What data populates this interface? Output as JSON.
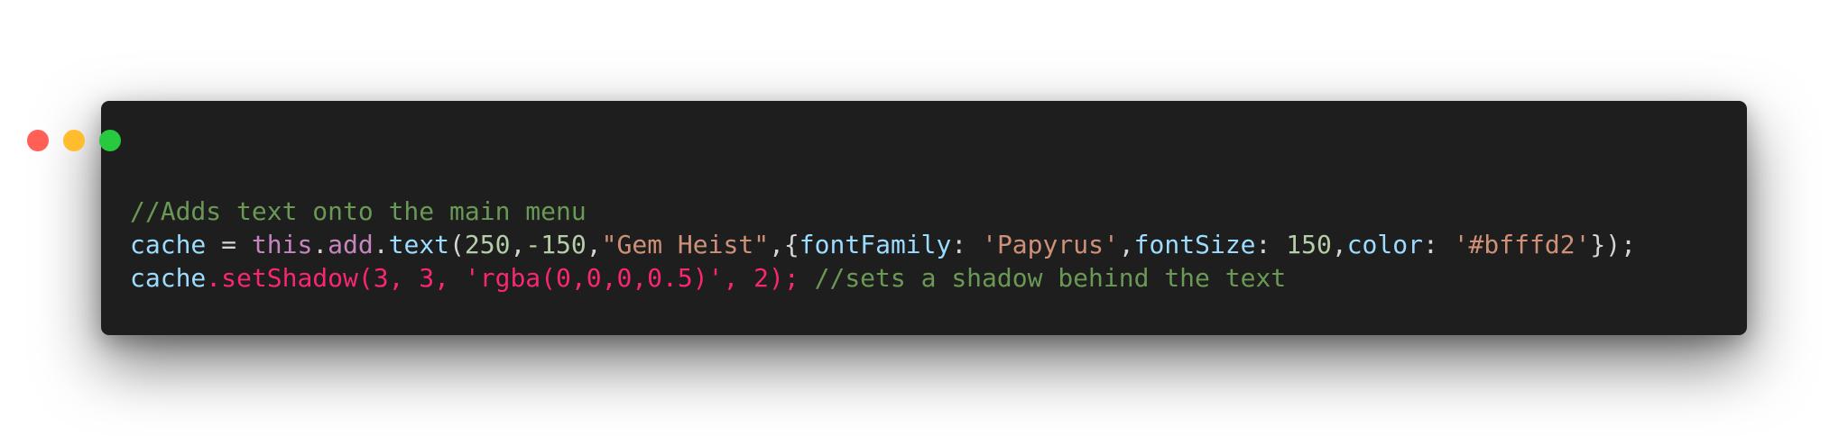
{
  "window": {
    "background": "#1e1e1e",
    "controls": [
      {
        "name": "close",
        "color": "#ff5f56"
      },
      {
        "name": "minimize",
        "color": "#ffbd2e"
      },
      {
        "name": "maximize",
        "color": "#27c93f"
      }
    ]
  },
  "colors": {
    "comment": "#6a9955",
    "variable": "#9cdcfe",
    "plain": "#d4d4d4",
    "keyword": "#c586c0",
    "function": "#dcdcaa",
    "number": "#b5cea8",
    "string": "#ce9178",
    "pink": "#f92672"
  },
  "code": {
    "line1": [
      {
        "t": "//Adds text onto the main menu",
        "c": "comment"
      }
    ],
    "line2": [
      {
        "t": "cache",
        "c": "variable"
      },
      {
        "t": " = ",
        "c": "plain"
      },
      {
        "t": "this",
        "c": "keyword"
      },
      {
        "t": ".",
        "c": "plain"
      },
      {
        "t": "add",
        "c": "keyword"
      },
      {
        "t": ".",
        "c": "plain"
      },
      {
        "t": "text",
        "c": "variable"
      },
      {
        "t": "(",
        "c": "plain"
      },
      {
        "t": "250",
        "c": "number"
      },
      {
        "t": ",",
        "c": "plain"
      },
      {
        "t": "-150",
        "c": "number"
      },
      {
        "t": ",",
        "c": "plain"
      },
      {
        "t": "\"Gem Heist\"",
        "c": "string"
      },
      {
        "t": ",{",
        "c": "plain"
      },
      {
        "t": "fontFamily",
        "c": "variable"
      },
      {
        "t": ": ",
        "c": "plain"
      },
      {
        "t": "'Papyrus'",
        "c": "string"
      },
      {
        "t": ",",
        "c": "plain"
      },
      {
        "t": "fontSize",
        "c": "variable"
      },
      {
        "t": ": ",
        "c": "plain"
      },
      {
        "t": "150",
        "c": "number"
      },
      {
        "t": ",",
        "c": "plain"
      },
      {
        "t": "color",
        "c": "variable"
      },
      {
        "t": ": ",
        "c": "plain"
      },
      {
        "t": "'#bfffd2'",
        "c": "string"
      },
      {
        "t": "});",
        "c": "plain"
      }
    ],
    "line3": [
      {
        "t": "cache",
        "c": "variable"
      },
      {
        "t": ".setShadow(3, 3, 'rgba(0,0,0,0.5)', 2);",
        "c": "pink"
      },
      {
        "t": " //sets a shadow behind the text",
        "c": "comment"
      }
    ]
  }
}
